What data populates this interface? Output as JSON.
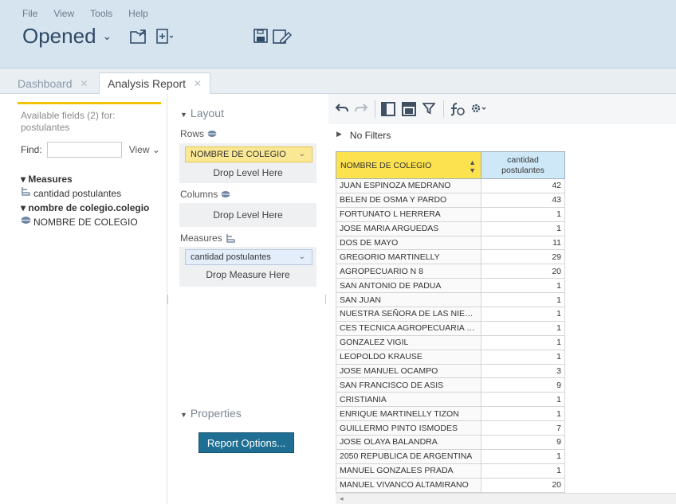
{
  "menu": [
    "File",
    "View",
    "Tools",
    "Help"
  ],
  "header": {
    "title": "Opened"
  },
  "tabs": [
    {
      "label": "Dashboard"
    },
    {
      "label": "Analysis Report"
    }
  ],
  "fields_panel": {
    "available_text": "Available fields (2) for: postulantes",
    "find_label": "Find:",
    "find_value": "",
    "view_label": "View",
    "tree": {
      "measures_header": "Measures",
      "measure_item": "cantidad postulantes",
      "dimension_header": "nombre de colegio.colegio",
      "dimension_item": "NOMBRE DE COLEGIO"
    }
  },
  "layout_panel": {
    "layout_title": "Layout",
    "rows_label": "Rows",
    "rows_chip": "NOMBRE DE COLEGIO",
    "rows_drop": "Drop Level Here",
    "columns_label": "Columns",
    "columns_drop": "Drop Level Here",
    "measures_label": "Measures",
    "measures_chip": "cantidad postulantes",
    "measures_drop": "Drop Measure Here",
    "properties_title": "Properties",
    "report_options_button": "Report Options..."
  },
  "report": {
    "filters_text": "No Filters",
    "col1_header": "NOMBRE DE COLEGIO",
    "col2_header_line1": "cantidad",
    "col2_header_line2": "postulantes",
    "rows": [
      {
        "name": "JUAN ESPINOZA MEDRANO",
        "value": "42"
      },
      {
        "name": "BELEN DE OSMA Y PARDO",
        "value": "43"
      },
      {
        "name": "FORTUNATO L HERRERA",
        "value": "1"
      },
      {
        "name": "JOSE MARIA ARGUEDAS",
        "value": "1"
      },
      {
        "name": "DOS DE MAYO",
        "value": "11"
      },
      {
        "name": "GREGORIO MARTINELLY",
        "value": "29"
      },
      {
        "name": "AGROPECUARIO N 8",
        "value": "20"
      },
      {
        "name": "SAN ANTONIO DE PADUA",
        "value": "1"
      },
      {
        "name": "SAN JUAN",
        "value": "1"
      },
      {
        "name": "NUESTRA SEÑORA DE LAS NIEVES",
        "value": "1"
      },
      {
        "name": "CES TECNICA AGROPECUARIA - AU...",
        "value": "1"
      },
      {
        "name": "GONZALEZ VIGIL",
        "value": "1"
      },
      {
        "name": "LEOPOLDO KRAUSE",
        "value": "1"
      },
      {
        "name": "JOSE MANUEL OCAMPO",
        "value": "3"
      },
      {
        "name": "SAN FRANCISCO DE ASIS",
        "value": "9"
      },
      {
        "name": "CRISTIANIA",
        "value": "1"
      },
      {
        "name": "ENRIQUE MARTINELLY TIZON",
        "value": "1"
      },
      {
        "name": "GUILLERMO PINTO ISMODES",
        "value": "7"
      },
      {
        "name": "JOSE OLAYA BALANDRA",
        "value": "9"
      },
      {
        "name": "2050 REPUBLICA DE ARGENTINA",
        "value": "1"
      },
      {
        "name": "MANUEL GONZALES PRADA",
        "value": "1"
      },
      {
        "name": "MANUEL VIVANCO ALTAMIRANO",
        "value": "20"
      }
    ]
  },
  "colors": {
    "topbar": "#d6e4f0",
    "accent_yellow": "#fce24e",
    "header_blue": "#cfe8f7",
    "button": "#1e6f93"
  }
}
